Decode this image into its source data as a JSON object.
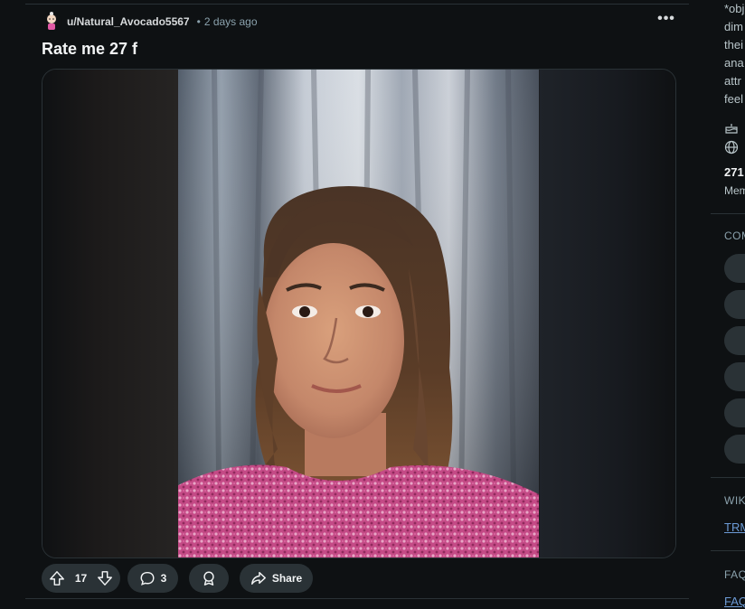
{
  "post": {
    "author": "u/Natural_Avocado5567",
    "separator": "•",
    "time": "2 days ago",
    "more_label": "•••",
    "title": "Rate me 27 f",
    "media_alt": "Selfie photo of a woman in a pink knit sweater in front of grey curtains"
  },
  "actions": {
    "upvote_icon": "upvote-arrow-icon",
    "score": "17",
    "downvote_icon": "downvote-arrow-icon",
    "comments_icon": "speech-bubble-icon",
    "comments_count": "3",
    "award_icon": "award-icon",
    "share_icon": "share-arrow-icon",
    "share_label": "Share"
  },
  "sidebar": {
    "description_lines": [
      "*obj",
      "dim",
      "thei",
      "ana",
      "attr",
      "feel"
    ],
    "member_count": "271",
    "members_label": "Mem",
    "community_heading": "COM",
    "wiki_heading": "WIK",
    "wiki_link": "TRM",
    "faq_heading": "FAQ",
    "faq_link": "FAQ"
  },
  "colors": {
    "background": "#0e1113",
    "pill": "#2a3236",
    "link": "#6c9bd6"
  }
}
